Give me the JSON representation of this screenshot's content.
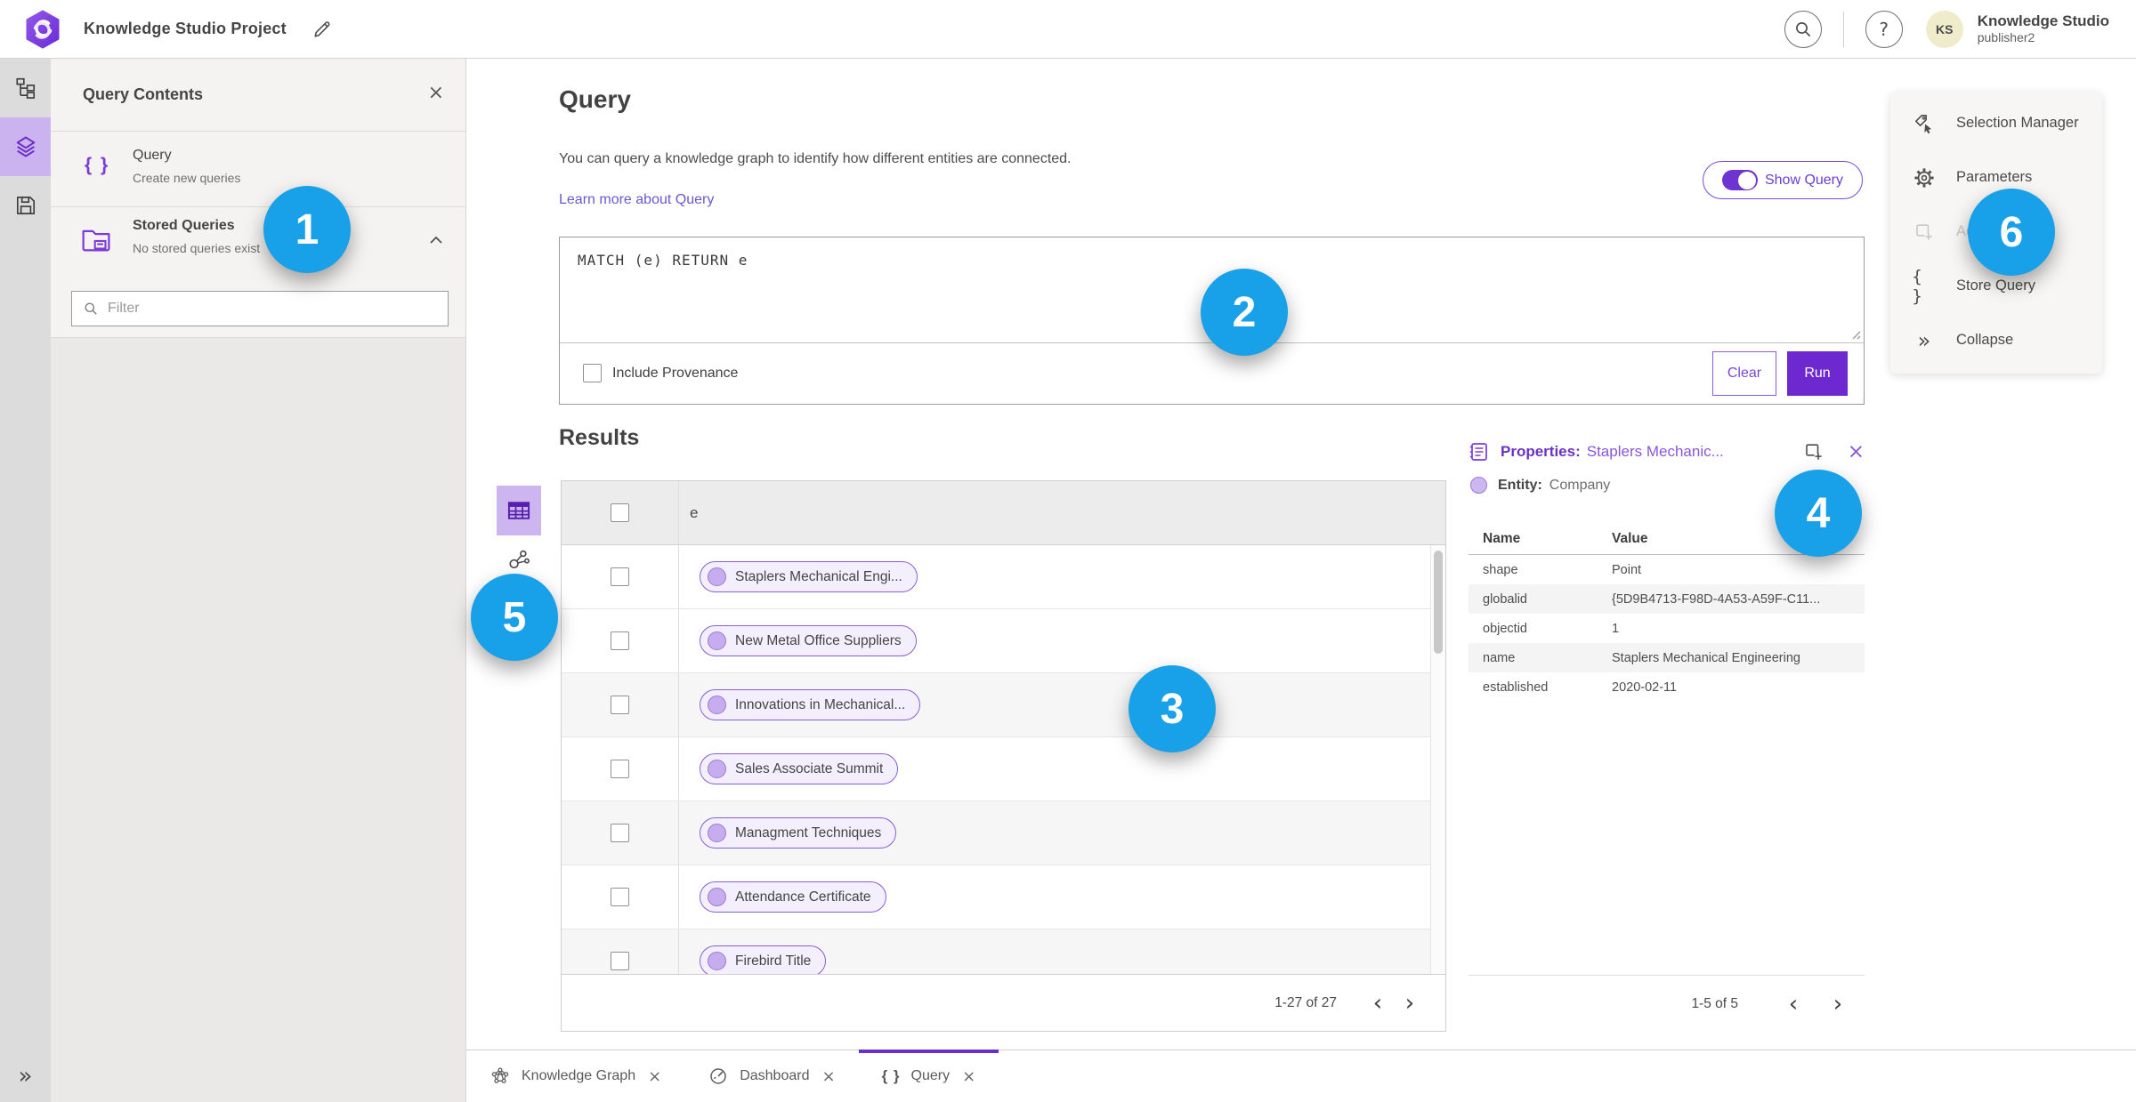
{
  "colors": {
    "accent_purple": "#6b2fd0",
    "purple_border": "#8a5cd8",
    "purple_light_bg": "#cdb6f0",
    "pill_bg": "#f4effc",
    "link": "#6a58d2",
    "badge_blue": "#18a0e8",
    "avatar_bg": "#eeeccb"
  },
  "glyphs": {
    "braces": "{ }",
    "collapse": "»",
    "expand": "»",
    "close": "×",
    "prev": "‹",
    "next": "›",
    "question": "?"
  },
  "topbar": {
    "title": "Knowledge Studio Project",
    "user": {
      "name": "Knowledge Studio",
      "role": "publisher2",
      "initials": "KS"
    }
  },
  "left_panel": {
    "title": "Query Contents",
    "query_item": {
      "label": "Query",
      "description": "Create new queries"
    },
    "stored_item": {
      "label": "Stored Queries",
      "description": "No stored queries exist"
    },
    "filter_placeholder": "Filter"
  },
  "query": {
    "heading": "Query",
    "description": "You can query a knowledge graph to identify how different entities are connected.",
    "learn_more": "Learn more about Query",
    "show_query": "Show Query",
    "text": "MATCH (e) RETURN e",
    "include_provenance": "Include Provenance",
    "clear": "Clear",
    "run": "Run"
  },
  "results": {
    "heading": "Results",
    "column": "e",
    "rows": [
      "Staplers Mechanical Engi...",
      "New Metal Office Suppliers",
      "Innovations in Mechanical...",
      "Sales Associate Summit",
      "Managment Techniques",
      "Attendance Certificate",
      "Firebird Title"
    ],
    "pagination": "1-27 of 27"
  },
  "properties": {
    "heading": "Properties:",
    "entity_name": "Staplers Mechanic...",
    "entity_label": "Entity:",
    "entity_type": "Company",
    "columns": {
      "name": "Name",
      "value": "Value"
    },
    "rows": [
      {
        "name": "shape",
        "value": "Point"
      },
      {
        "name": "globalid",
        "value": "{5D9B4713-F98D-4A53-A59F-C11..."
      },
      {
        "name": "objectid",
        "value": "1"
      },
      {
        "name": "name",
        "value": "Staplers Mechanical Engineering"
      },
      {
        "name": "established",
        "value": "2020-02-11"
      }
    ],
    "pagination": "1-5 of 5"
  },
  "side_menu": {
    "items": [
      {
        "label": "Selection Manager"
      },
      {
        "label": "Parameters"
      },
      {
        "label": "Add"
      },
      {
        "label": "Store Query"
      },
      {
        "label": "Collapse"
      }
    ]
  },
  "tabs": [
    {
      "label": "Knowledge Graph"
    },
    {
      "label": "Dashboard"
    },
    {
      "label": "Query"
    }
  ],
  "badges": [
    "1",
    "2",
    "3",
    "4",
    "5",
    "6"
  ]
}
